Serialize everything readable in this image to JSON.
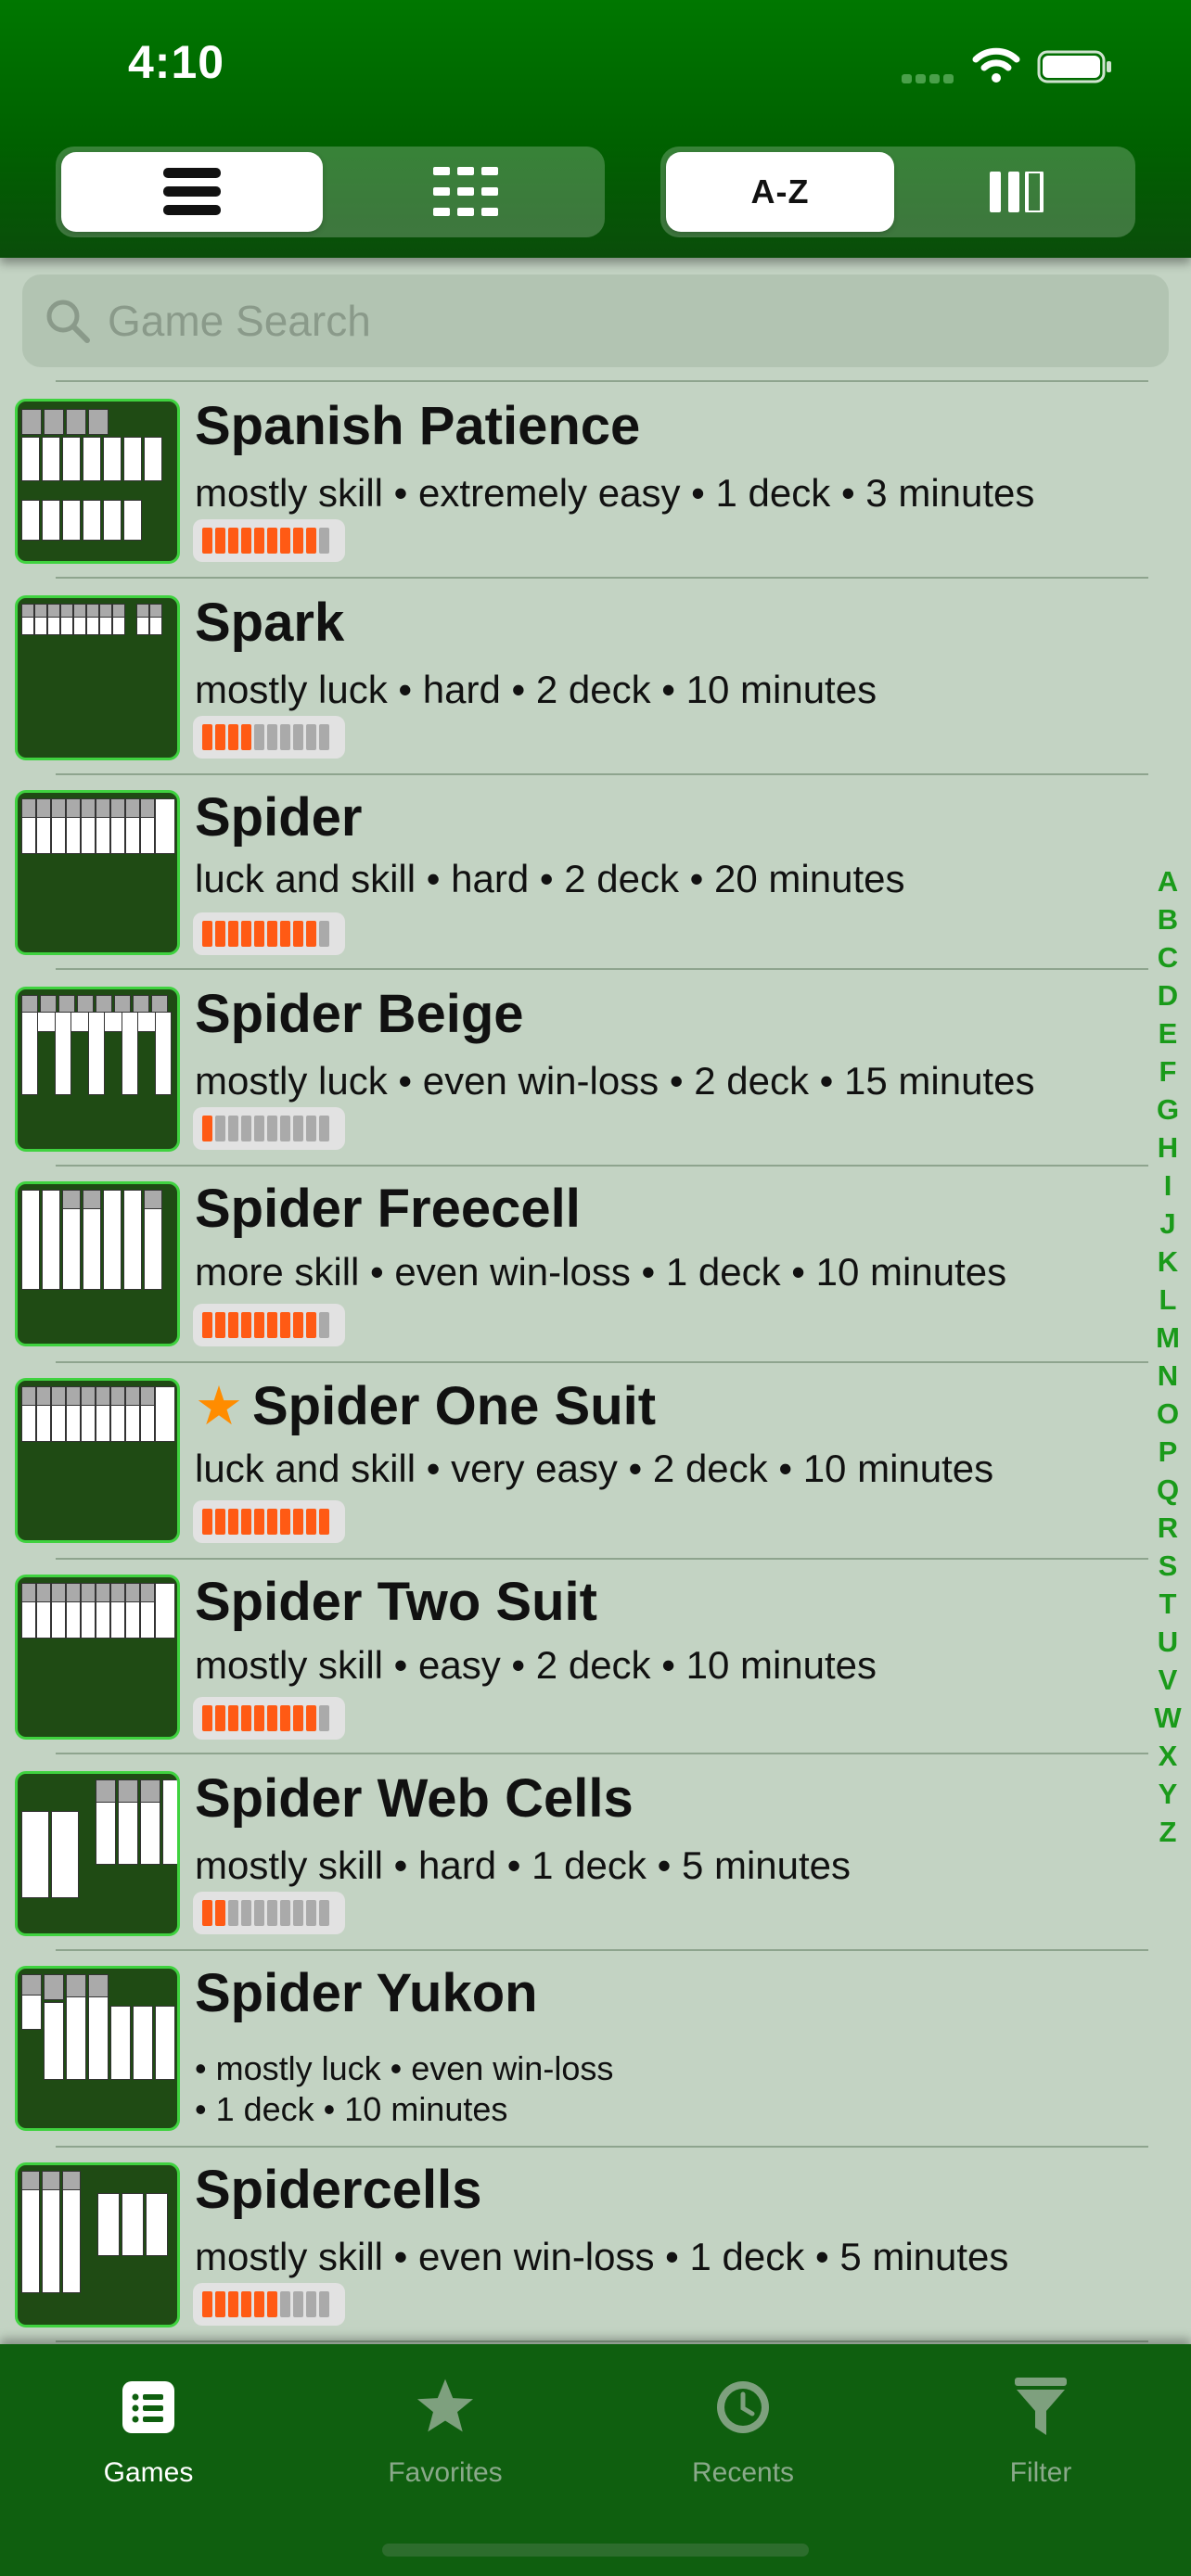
{
  "status_bar": {
    "time": "4:10"
  },
  "toolbar": {
    "sort_az_label": "A-Z"
  },
  "search": {
    "placeholder": "Game Search"
  },
  "games": [
    {
      "name": "Spanish Patience",
      "favorite": false,
      "meta": "mostly skill • extremely easy • 1 deck • 3 minutes",
      "rating_filled": 9
    },
    {
      "name": "Spark",
      "favorite": false,
      "meta": "mostly luck • hard • 2 deck • 10 minutes",
      "rating_filled": 4
    },
    {
      "name": "Spider",
      "favorite": false,
      "meta": "luck and skill • hard • 2 deck • 20 minutes",
      "rating_filled": 9
    },
    {
      "name": "Spider Beige",
      "favorite": false,
      "meta": "mostly luck • even win-loss • 2 deck • 15 minutes",
      "rating_filled": 1
    },
    {
      "name": "Spider Freecell",
      "favorite": false,
      "meta": "more skill • even win-loss • 1 deck • 10 minutes",
      "rating_filled": 9
    },
    {
      "name": "Spider One Suit",
      "favorite": true,
      "meta": "luck and skill • very easy • 2 deck • 10 minutes",
      "rating_filled": 10
    },
    {
      "name": "Spider Two Suit",
      "favorite": false,
      "meta": "mostly skill • easy • 2 deck • 10 minutes",
      "rating_filled": 9
    },
    {
      "name": "Spider Web Cells",
      "favorite": false,
      "meta": "mostly skill • hard • 1 deck • 5 minutes",
      "rating_filled": 2
    },
    {
      "name": "Spider Yukon",
      "favorite": false,
      "meta_line1": "• mostly luck • even win-loss",
      "meta_line2": "• 1 deck • 10 minutes"
    },
    {
      "name": "Spidercells",
      "favorite": false,
      "meta": "mostly skill • even win-loss • 1 deck • 5 minutes",
      "rating_filled": 6
    }
  ],
  "rating_scale": 10,
  "alpha_index": [
    "A",
    "B",
    "C",
    "D",
    "E",
    "F",
    "G",
    "H",
    "I",
    "J",
    "K",
    "L",
    "M",
    "N",
    "O",
    "P",
    "Q",
    "R",
    "S",
    "T",
    "U",
    "V",
    "W",
    "X",
    "Y",
    "Z"
  ],
  "tabs": [
    {
      "label": "Games",
      "icon": "list-icon",
      "active": true
    },
    {
      "label": "Favorites",
      "icon": "star-icon",
      "active": false
    },
    {
      "label": "Recents",
      "icon": "clock-icon",
      "active": false
    },
    {
      "label": "Filter",
      "icon": "funnel-icon",
      "active": false
    }
  ],
  "colors": {
    "header_green": "#006b00",
    "meter_on": "#ff5a14",
    "index_green": "#1a9a1a",
    "favorite_star": "#ff8c00"
  }
}
